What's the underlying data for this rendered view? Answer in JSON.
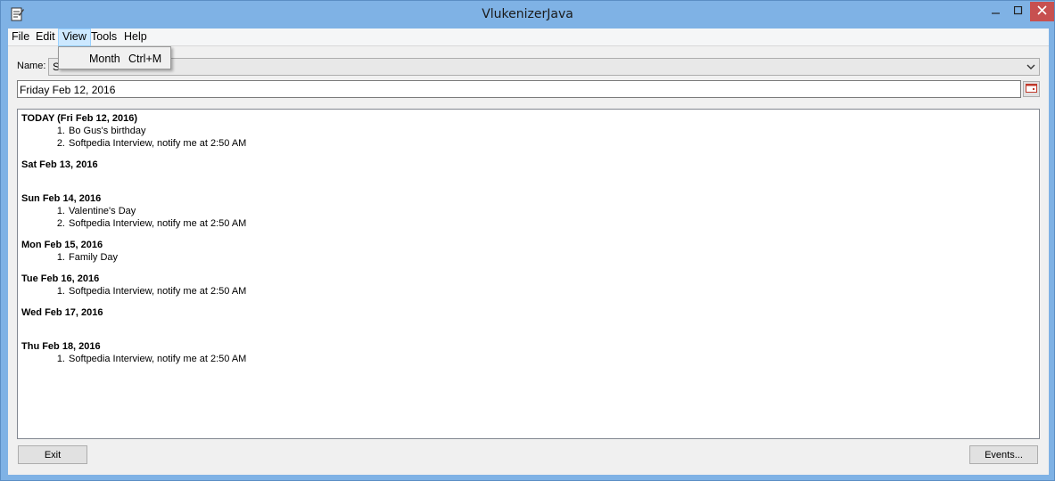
{
  "window": {
    "title": "VlukenizerJava"
  },
  "menubar": {
    "items": [
      "File",
      "Edit",
      "View",
      "Tools",
      "Help"
    ]
  },
  "view_menu": {
    "item_label": "Month",
    "item_shortcut": "Ctrl+M"
  },
  "name_field": {
    "label": "Name:",
    "value": "S"
  },
  "date_field": {
    "value": "Friday Feb 12, 2016"
  },
  "agenda": {
    "days": [
      {
        "heading": "TODAY (Fri Feb 12, 2016)",
        "events": [
          "Bo Gus's birthday",
          "Softpedia Interview, notify me at 2:50 AM"
        ]
      },
      {
        "heading": "Sat Feb 13, 2016",
        "events": []
      },
      {
        "heading": "Sun Feb 14, 2016",
        "events": [
          "Valentine's Day",
          "Softpedia Interview, notify me at 2:50 AM"
        ]
      },
      {
        "heading": "Mon Feb 15, 2016",
        "events": [
          "Family Day"
        ]
      },
      {
        "heading": "Tue Feb 16, 2016",
        "events": [
          "Softpedia Interview, notify me at 2:50 AM"
        ]
      },
      {
        "heading": "Wed Feb 17, 2016",
        "events": []
      },
      {
        "heading": "Thu Feb 18, 2016",
        "events": [
          "Softpedia Interview, notify me at 2:50 AM"
        ]
      }
    ]
  },
  "buttons": {
    "exit": "Exit",
    "events": "Events..."
  },
  "icons": {
    "app": "notepad-icon",
    "minimize": "minimize-icon",
    "maximize": "maximize-icon",
    "close": "close-icon",
    "dropdown": "chevron-down-icon",
    "calendar": "calendar-icon"
  },
  "colors": {
    "titlebar": "#7fb2e5",
    "close_button": "#c75050",
    "menu_highlight": "#cce8ff"
  }
}
